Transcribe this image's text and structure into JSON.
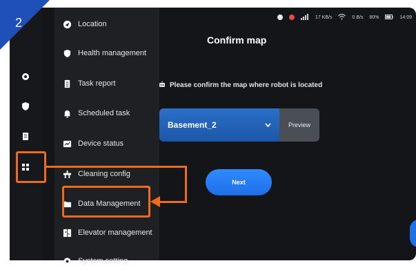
{
  "step": {
    "number": "2"
  },
  "status_bar": {
    "network_speed_1": "17",
    "network_unit_1": "KB/s",
    "network_speed_2": "0",
    "network_unit_2": "B/s",
    "battery": "80%",
    "time": "14:09"
  },
  "menu": {
    "items": [
      {
        "label": "Location",
        "icon": "location-icon"
      },
      {
        "label": "Health management",
        "icon": "shield-icon"
      },
      {
        "label": "Task report",
        "icon": "clipboard-icon"
      },
      {
        "label": "Scheduled task",
        "icon": "bell-icon"
      },
      {
        "label": "Device status",
        "icon": "chart-icon"
      },
      {
        "label": "Cleaning config",
        "icon": "cleaning-icon"
      },
      {
        "label": "Data Management",
        "icon": "folder-icon"
      },
      {
        "label": "Elevator management",
        "icon": "elevator-icon"
      },
      {
        "label": "System setting",
        "icon": "gear-icon"
      }
    ]
  },
  "main": {
    "title": "Confirm map",
    "prompt": "Please confirm the map where robot is located",
    "map_value": "Basement_2",
    "preview_label": "Preview",
    "next_label": "Next"
  },
  "colors": {
    "annotation": "#f06c1b",
    "primary": "#1f6fe6",
    "step_badge": "#1f4fb8"
  }
}
